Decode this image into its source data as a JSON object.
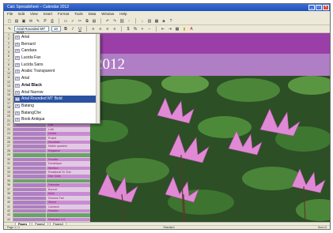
{
  "window": {
    "title": "Calc Spreadsheet – Calendar 2012"
  },
  "menu": [
    "File",
    "Edit",
    "View",
    "Insert",
    "Format",
    "Tools",
    "Data",
    "Window",
    "Help"
  ],
  "toolbar1_icons": [
    "new-icon",
    "open-icon",
    "save-icon",
    "email-icon",
    "edit-icon",
    "pdf-icon",
    "print-icon",
    "preview-icon",
    "spellcheck-icon",
    "cut-icon",
    "copy-icon",
    "paste-icon",
    "undo-icon",
    "redo-icon",
    "hyperlink-icon",
    "sort-asc-icon",
    "sort-desc-icon",
    "chart-icon",
    "gallery-icon",
    "navigator-icon",
    "help-icon"
  ],
  "font_name": {
    "value": "Arial Rounded MT Bold",
    "size": "10"
  },
  "font_list": [
    {
      "label": "Arial"
    },
    {
      "label": "Bernard"
    },
    {
      "label": "Candara"
    },
    {
      "label": "Lucida Fax"
    },
    {
      "label": "Lucida Sans"
    },
    {
      "label": "Arabic Transparent"
    },
    {
      "label": "Arial"
    },
    {
      "label": "Arial Black"
    },
    {
      "label": "Arial Narrow"
    },
    {
      "label": "Arial Rounded MT Bold",
      "selected": true
    },
    {
      "label": "Batang"
    },
    {
      "label": "BatangChe"
    },
    {
      "label": "Book Antiqua"
    }
  ],
  "banner": {
    "year": "2012"
  },
  "grid_rows": [
    {
      "n": "1",
      "b": ""
    },
    {
      "n": "2",
      "b": ""
    },
    {
      "n": "3",
      "b": ""
    },
    {
      "n": "4",
      "b": ""
    },
    {
      "n": "5",
      "b": ""
    },
    {
      "n": "6",
      "b": ""
    },
    {
      "n": "7",
      "b": ""
    },
    {
      "n": "8",
      "b": ""
    },
    {
      "n": "9",
      "b": ""
    },
    {
      "n": "10",
      "b": ""
    },
    {
      "n": "11",
      "b": ""
    },
    {
      "n": "12",
      "b": ""
    },
    {
      "n": "13",
      "b": ""
    },
    {
      "n": "14",
      "b": ""
    },
    {
      "n": "15",
      "b": ""
    },
    {
      "n": "16",
      "b": ""
    },
    {
      "n": "17",
      "b": ""
    },
    {
      "n": "18",
      "b": ""
    },
    {
      "n": "19",
      "b": ""
    },
    {
      "n": "20",
      "b": ""
    },
    {
      "n": "21",
      "b": "Ostara"
    },
    {
      "n": "22",
      "b": "Dali"
    },
    {
      "n": "23",
      "b": "Lotti"
    },
    {
      "n": "24",
      "b": "Dahlia"
    },
    {
      "n": "25",
      "b": "Prairie"
    },
    {
      "n": "26",
      "b": "Mondiale"
    },
    {
      "n": "27",
      "b": "Mable quarters"
    },
    {
      "n": "28",
      "b": "Elegance"
    },
    {
      "n": "29",
      "b": ""
    },
    {
      "n": "30",
      "b": "Ponette"
    },
    {
      "n": "31",
      "b": "Dominique"
    },
    {
      "n": "32",
      "b": "Stretton"
    },
    {
      "n": "33",
      "b": "Rotational St. Eve"
    },
    {
      "n": "34",
      "b": "Dior Colis"
    },
    {
      "n": "35",
      "b": ""
    },
    {
      "n": "36",
      "b": "Palmstar"
    },
    {
      "n": "37",
      "b": "Bonnet"
    },
    {
      "n": "38",
      "b": "Mole"
    },
    {
      "n": "39",
      "b": "Dreams Fair"
    },
    {
      "n": "40",
      "b": "Sirene"
    },
    {
      "n": "41",
      "b": "Lamarck"
    },
    {
      "n": "42",
      "b": "Pavilion"
    },
    {
      "n": "43",
      "b": ""
    },
    {
      "n": "44",
      "b": "Retention 2.0"
    }
  ],
  "sheet_tabs": [
    {
      "label": "Pages",
      "active": true
    },
    {
      "label": "Pages2"
    },
    {
      "label": "Pages3"
    }
  ],
  "status": {
    "left": "Page 1 / 1",
    "mid": "Standard",
    "right": "Sum=0"
  },
  "colors": {
    "purple_dark": "#9b3fa8",
    "purple_light": "#b07ec4",
    "row_highlight": "#c98ad6",
    "row_green": "#69a26b"
  }
}
